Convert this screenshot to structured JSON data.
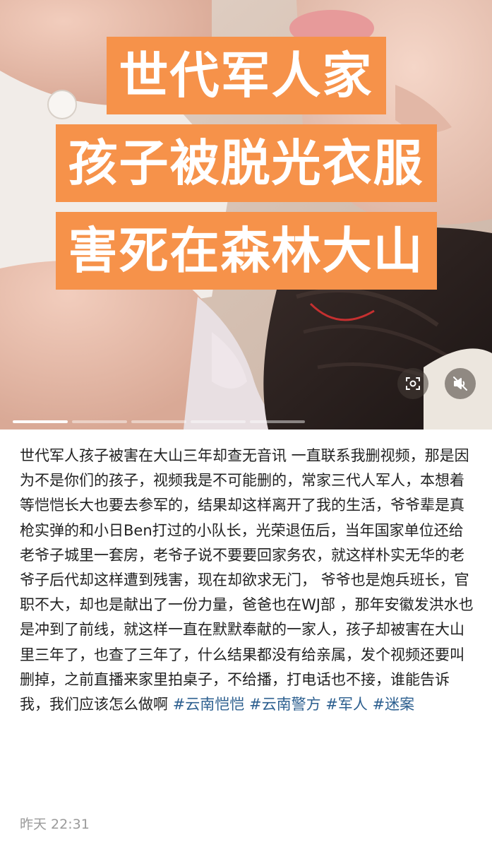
{
  "headline": {
    "line1": "世代军人家",
    "line2": "孩子被脱光衣服",
    "line3": "害死在森林大山"
  },
  "icons": {
    "scan": "scan-icon",
    "mute": "speaker-muted-icon"
  },
  "colors": {
    "headline_bg": "#f6924a",
    "headline_text": "#ffffff",
    "hashtag": "#2c5f8f",
    "timestamp": "#9a9a9a"
  },
  "media": {
    "slide_count": 5,
    "active_slide": 1
  },
  "post": {
    "body": "世代军人孩子被害在大山三年却查无音讯 一直联系我删视频，那是因为不是你们的孩子，视频我是不可能删的，常家三代人军人，本想着等恺恺长大也要去参军的，结果却这样离开了我的生活，爷爷辈是真枪实弹的和小日Ben打过的小队长，光荣退伍后，当年国家单位还给老爷子城里一套房，老爷子说不要要回家务农，就这样朴实无华的老爷子后代却这样遭到残害，现在却欲求无门， 爷爷也是炮兵班长，官职不大，却也是献出了一份力量，爸爸也在WJ部 ，那年安徽发洪水也是冲到了前线，就这样一直在默默奉献的一家人，孩子却被害在大山里三年了，也查了三年了，什么结果都没有给亲属，发个视频还要叫删掉，之前直播来家里拍桌子，不给播，打电话也不接，谁能告诉我，我们应该怎么做啊 ",
    "hashtags": [
      "#云南恺恺",
      "#云南警方",
      "#军人",
      "#迷案"
    ],
    "timestamp": "昨天 22:31"
  }
}
